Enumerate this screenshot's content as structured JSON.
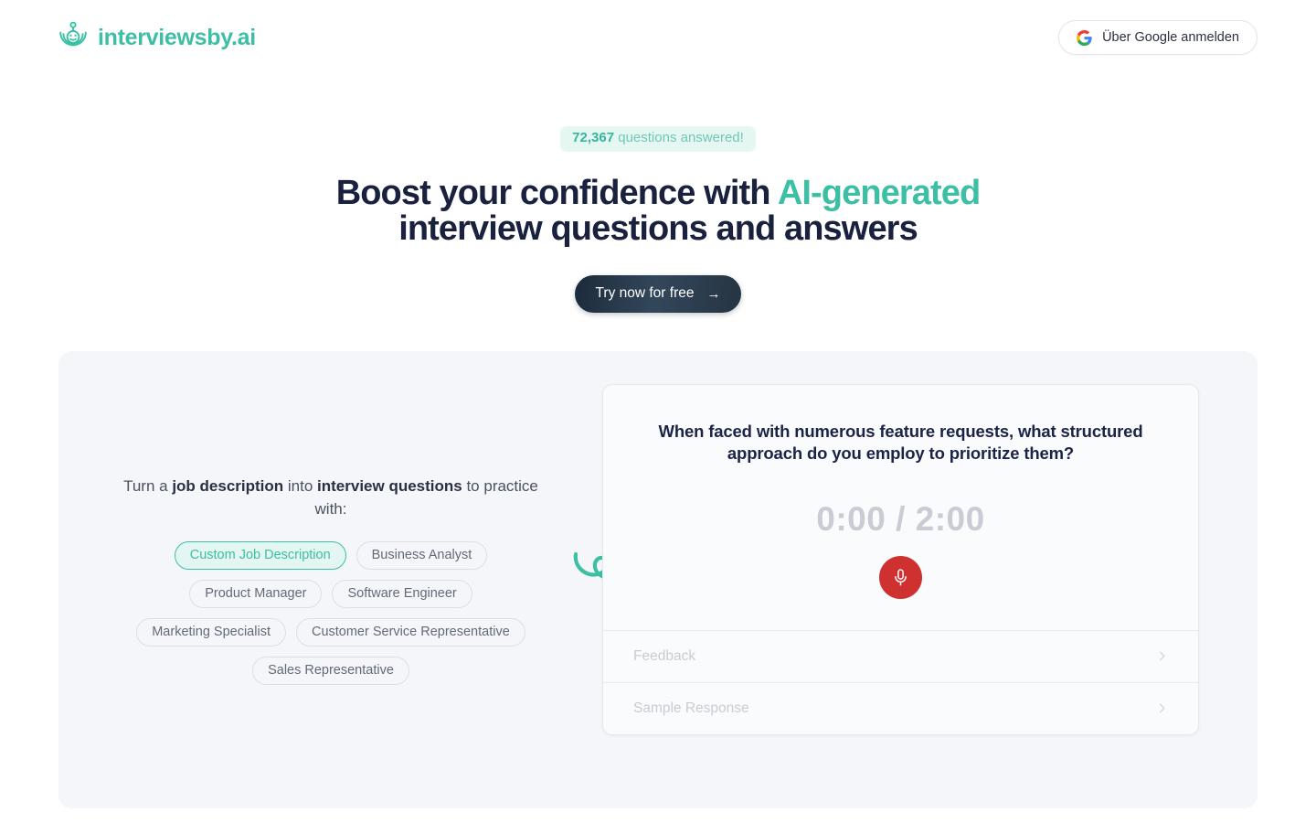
{
  "brand": {
    "name": "interviewsby.ai",
    "icon": "robot-head-icon",
    "color": "#3cbfa4"
  },
  "header": {
    "google_button": {
      "label": "Über Google anmelden",
      "icon": "google-g-icon"
    }
  },
  "hero": {
    "counter_count": "72,367",
    "counter_suffix": " questions answered!",
    "title_line1_pre": "Boost your confidence with ",
    "title_accent": "AI-generated",
    "title_line2": "interview questions and answers",
    "cta_label": "Try now for free",
    "cta_arrow": "→"
  },
  "showcase": {
    "lede_pre": "Turn a ",
    "lede_bold1": "job description",
    "lede_mid": " into ",
    "lede_bold2": "interview questions",
    "lede_post": " to practice with:",
    "chips": [
      {
        "label": "Custom Job Description",
        "selected": true
      },
      {
        "label": "Business Analyst",
        "selected": false
      },
      {
        "label": "Product Manager",
        "selected": false
      },
      {
        "label": "Software Engineer",
        "selected": false
      },
      {
        "label": "Marketing Specialist",
        "selected": false
      },
      {
        "label": "Customer Service Representative",
        "selected": false
      },
      {
        "label": "Sales Representative",
        "selected": false
      }
    ],
    "decoration_icon": "curly-arrow-icon"
  },
  "interview_card": {
    "question": "When faced with numerous feature requests, what structured approach do you employ to prioritize them?",
    "timer_elapsed": "0:00",
    "timer_separator": " / ",
    "timer_total": "2:00",
    "timer_display": "0:00 / 2:00",
    "mic_button_icon": "microphone-icon",
    "rows": [
      {
        "label": "Feedback",
        "icon": "chevron-right-icon"
      },
      {
        "label": "Sample Response",
        "icon": "chevron-right-icon"
      }
    ]
  },
  "colors": {
    "accent_teal": "#3cbfa4",
    "heading_navy": "#19213f",
    "panel_bg": "#f5f6f9",
    "mic_red": "#cf3030",
    "muted_gray": "#c8ccd3"
  }
}
